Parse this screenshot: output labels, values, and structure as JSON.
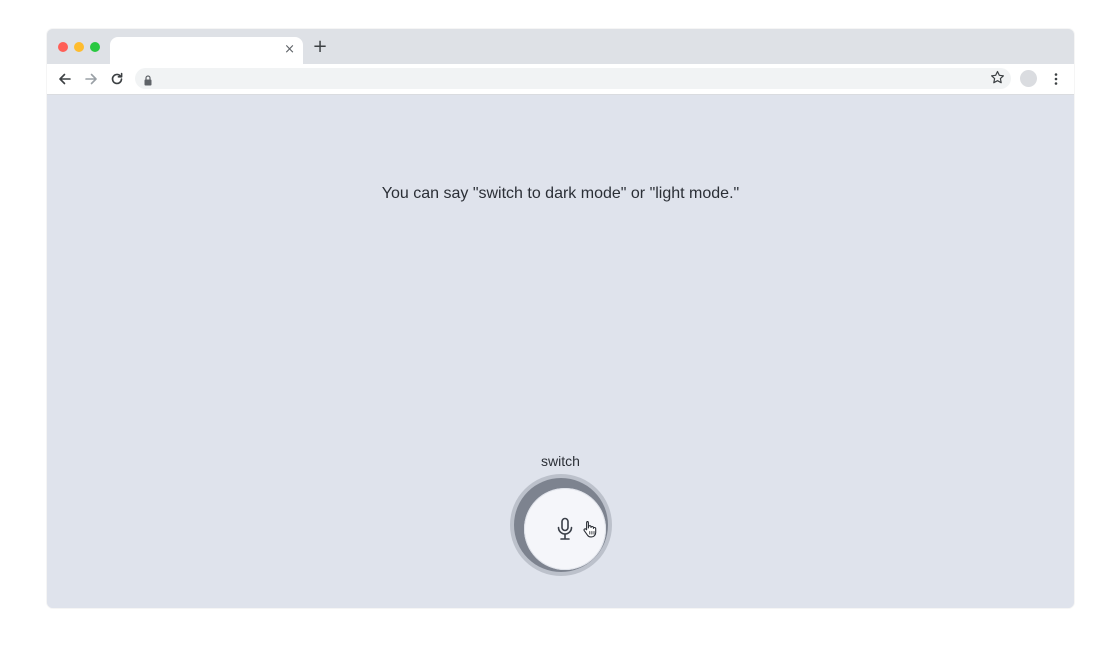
{
  "browser": {
    "tab_title": "",
    "tab_close_glyph": "×",
    "new_tab_glyph": "+",
    "url": ""
  },
  "page": {
    "hint_text": "You can say \"switch to dark mode\" or \"light mode.\"",
    "transcript": "switch"
  },
  "icons": {
    "back": "arrow-left-icon",
    "forward": "arrow-right-icon",
    "reload": "reload-icon",
    "lock": "lock-icon",
    "bookmark": "star-icon",
    "profile": "profile-icon",
    "menu": "kebab-menu-icon",
    "mic": "microphone-icon",
    "cursor": "hand-pointer-icon"
  },
  "colors": {
    "page_background": "#dfe3ec",
    "mic_ring": "#7d838f",
    "mic_button": "#f5f6fa",
    "text": "#2b2f36"
  }
}
